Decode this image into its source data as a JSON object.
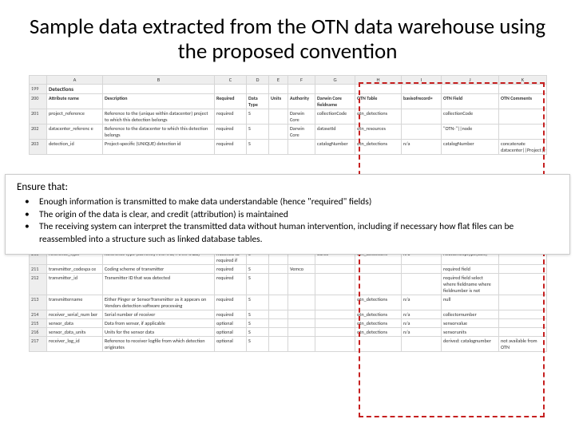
{
  "title": "Sample data extracted from the OTN data warehouse using the proposed convention",
  "cols": [
    "",
    "A",
    "B",
    "C",
    "D",
    "E",
    "F",
    "G",
    "H",
    "I",
    "J",
    "K"
  ],
  "section_row": {
    "num": "199",
    "label": "Detections"
  },
  "header_row": {
    "num": "200",
    "attr": "Attribute name",
    "desc": "Description",
    "req": "Required",
    "dtype": "Data Type",
    "units": "Units",
    "auth": "Authority",
    "dcore": "Darwin Core fieldname",
    "otable": "OTN Table",
    "basis": "basisofrecord=",
    "ofield": "OTN Field",
    "ocomm": "OTN Comments"
  },
  "rows_top": [
    {
      "num": "201",
      "attr": "project_reference",
      "desc": "Reference to the (unique within datacenter) project to which this detection belongs",
      "req": "required",
      "dtype": "S",
      "auth": "Darwin Core",
      "dcore": "collectionCode",
      "otable": "otn_detections",
      "ofield": "collectionCode"
    },
    {
      "num": "202",
      "attr": "datacenter_referenc e",
      "desc": "Reference to the datacenter to which this detection belongs",
      "req": "required",
      "dtype": "S",
      "auth": "Darwin Core",
      "dcore": "datasetId",
      "otable": "otn_resources",
      "ofield": "\"OTN-\"||node"
    },
    {
      "num": "203",
      "attr": "detection_id",
      "desc": "Project-specific (UNIQUE) detection id",
      "req": "required",
      "dtype": "S",
      "dcore": "catalogNumber",
      "otable": "otn_detections",
      "basis": "n/a",
      "ofield": "catalogNumber",
      "ocomm": "concatenate datacenter||Project||tag"
    }
  ],
  "rows_bottom": [
    {
      "num": "210",
      "attr": "reference_type",
      "desc": "Reference type (currently ANIMAL, MANMADE)",
      "req": "matched to required if",
      "dtype": "S",
      "dcore": "ource",
      "otable": "otn_detections",
      "basis": "n/a",
      "ofield": "relationshiptype(obis)"
    },
    {
      "num": "211",
      "attr": "transmitter_codespa ce",
      "desc": "Coding scheme of transmitter",
      "req": "required",
      "dtype": "S",
      "auth": "Vemco",
      "ofield": "required field"
    },
    {
      "num": "212",
      "attr": "transmitter_id",
      "desc": "Transmitter ID that was detected",
      "req": "required",
      "dtype": "S",
      "ofield": "required field select where fieldname where fieldnumber is not"
    },
    {
      "num": "213",
      "attr": "transmittername",
      "desc": "Either Pinger or SensorTransmitter as it appears on Vendors detection software processing",
      "req": "required",
      "dtype": "S",
      "otable": "otn_detections",
      "basis": "n/a",
      "ofield": "null"
    },
    {
      "num": "214",
      "attr": "receiver_serial_num ber",
      "desc": "Serial number of receiver",
      "req": "required",
      "dtype": "S",
      "otable": "otn_detections",
      "basis": "n/a",
      "ofield": "collectornumber"
    },
    {
      "num": "215",
      "attr": "sensor_data",
      "desc": "Data from sensor, if applicable",
      "req": "optional",
      "dtype": "S",
      "otable": "otn_detections",
      "basis": "n/a",
      "ofield": "sensorvalue"
    },
    {
      "num": "216",
      "attr": "sensor_data_units",
      "desc": "Units for the sensor data",
      "req": "optional",
      "dtype": "S",
      "otable": "otn_detections",
      "basis": "n/a",
      "ofield": "sensorunits"
    },
    {
      "num": "217",
      "attr": "receiver_log_id",
      "desc": "Reference to receiver logfile from which detection originates",
      "req": "optional",
      "dtype": "S",
      "ofield": "derived: catalognumber",
      "ocomm": "not available from OTN"
    }
  ],
  "overlay": {
    "heading": "Ensure that:",
    "b1": "Enough information is transmitted to make data understandable (hence \"required\" fields)",
    "b2": "The origin of the data is clear, and credit (attribution) is maintained",
    "b3": "The receiving system can interpret the transmitted data without human intervention, including if necessary how flat files can be reassembled into a structure such as linked database tables."
  }
}
